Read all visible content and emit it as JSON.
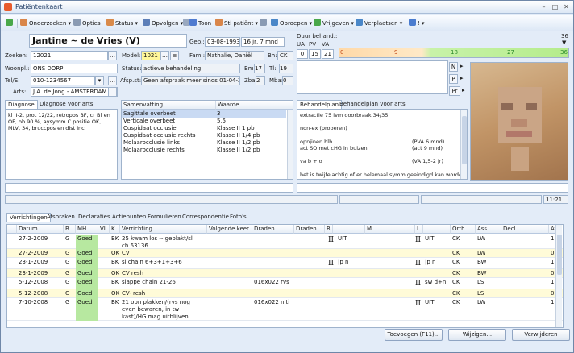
{
  "window": {
    "title": "Patiëntenkaart"
  },
  "toolbar": {
    "items": [
      "Onderzoeken",
      "Opties",
      "Status",
      "Opvolgen",
      "Toon",
      "Stl patiënt",
      "Oproepen",
      "Vrijgeven",
      "Verplaatsen",
      "!"
    ]
  },
  "patient": {
    "name": "Jantine ~ de Vries (V)",
    "geb_label": "Geb.:",
    "geb": "03-08-1993",
    "age": "16 jr, 7 mnd",
    "zoeken_label": "Zoeken:",
    "zoeken": "12021",
    "model_label": "Model:",
    "model": "1021",
    "fam_label": "Fam.:",
    "fam": "Nathalie, Daniël",
    "bh_label": "Bh:",
    "bh": "CK",
    "woonpl_label": "Woonpl.:",
    "woonpl": "ONS DORP",
    "status_label": "Status:",
    "status": "actieve behandeling",
    "bm_label": "Bm:",
    "bm": "17",
    "ti_label": "Tl:",
    "ti": "19",
    "tel_label": "Tel/E:",
    "tel": "010-1234567",
    "afsp_label": "Afsp.st:",
    "afsp": "Geen afspraak meer sinds 01-04-2009",
    "zba_label": "Zba:",
    "zba": "2",
    "mba_label": "Mba:",
    "mba": "0",
    "arts_label": "Arts:",
    "arts": "J.A. de Jong - AMSTERDAM - 020-1234567"
  },
  "duration": {
    "label": "Duur behand.:",
    "cols": [
      "UA",
      "PV",
      "VA"
    ],
    "values": [
      "0",
      "15",
      "21"
    ],
    "scale_ticks": [
      "0",
      "9",
      "18",
      "27",
      "36"
    ],
    "scale_max": "36",
    "progress": 21
  },
  "side_buttons": [
    "N",
    "P",
    "Pr"
  ],
  "diagnose": {
    "tabs": [
      "Diagnose",
      "Diagnose voor arts"
    ],
    "text": "kl II-2, prot 12/22, retropos BF, cr Bf en OF, ob 90 %, aysymm C positie OK, MLV, 34, bruccpos en dist incl"
  },
  "summary": {
    "headers": [
      "Samenvatting",
      "Waarde"
    ],
    "rows": [
      [
        "Sagittale overbeet",
        "3"
      ],
      [
        "Verticale overbeet",
        "5,5"
      ],
      [
        "Cuspidaat occlusie",
        "Klasse II 1 pb"
      ],
      [
        "Cuspidaat occlusie rechts",
        "Klasse II 1/4 pb"
      ],
      [
        "Molaarocclusie links",
        "Klasse II 1/2 pb"
      ],
      [
        "Molaarocclusie rechts",
        "Klasse II 1/2 pb"
      ]
    ]
  },
  "plan": {
    "tabs": [
      "Behandelplan",
      "Behandelplan voor arts"
    ],
    "lines": [
      [
        "extractie 75 ivm doorbraak 34/35",
        ""
      ],
      [
        "",
        ""
      ],
      [
        "non-ex (proberen)",
        ""
      ],
      [
        "",
        ""
      ],
      [
        "opnjinen blb",
        "(PVA 6 mnd)"
      ],
      [
        "act SO met cHG in buizen",
        "(act 9 mnd)"
      ],
      [
        "",
        ""
      ],
      [
        "va b + o",
        "(VA 1,5-2 jr)"
      ],
      [
        "",
        ""
      ],
      [
        "het is twijfelachtig of er helemaal symm geeindigd kan worden",
        ""
      ]
    ]
  },
  "status_time": "11:21",
  "bottom_tabs": [
    "Verrichtingen",
    "Afspraken",
    "Declaraties",
    "Actiepunten",
    "Formulieren",
    "Correspondentie",
    "Foto's"
  ],
  "grid": {
    "headers": [
      "",
      "Datum",
      "B.",
      "MH",
      "VI",
      "K",
      "Verrichting",
      "Volgende keer",
      "Draden",
      "Draden",
      "R..",
      "",
      "M..",
      "",
      "L..",
      "",
      "Orth.",
      "Ass.",
      "Decl.",
      "Af"
    ],
    "rows": [
      {
        "datum": "27-2-2009",
        "b": "G",
        "mh": "Goed",
        "k": "BK",
        "verr": "25 kwam los -- geplakt/sl ch 63136",
        "vk": "",
        "d1": "",
        "d2": "",
        "r": "II",
        "r2": "UIT",
        "l": "II",
        "l2": "UIT",
        "orth": "CK",
        "ass": "LW",
        "af": "1",
        "hl": false
      },
      {
        "datum": "27-2-2009",
        "b": "G",
        "mh": "Goed",
        "k": "OK",
        "verr": "CV",
        "vk": "",
        "d1": "",
        "d2": "",
        "r": "",
        "r2": "",
        "l": "",
        "l2": "",
        "orth": "CK",
        "ass": "LW",
        "af": "0",
        "hl": true
      },
      {
        "datum": "23-1-2009",
        "b": "G",
        "mh": "Goed",
        "k": "BK",
        "verr": "sl chain 6+3+1+3+6",
        "vk": "",
        "d1": "",
        "d2": "",
        "r": "II",
        "r2": "|p n",
        "l": "II",
        "l2": "|p n",
        "orth": "CK",
        "ass": "BW",
        "af": "1",
        "hl": false
      },
      {
        "datum": "23-1-2009",
        "b": "G",
        "mh": "Goed",
        "k": "OK",
        "verr": "CV resh",
        "vk": "",
        "d1": "",
        "d2": "",
        "r": "",
        "r2": "",
        "l": "",
        "l2": "",
        "orth": "CK",
        "ass": "BW",
        "af": "0",
        "hl": true
      },
      {
        "datum": "5-12-2008",
        "b": "G",
        "mh": "Goed",
        "k": "BK",
        "verr": "slappe chain 21-26",
        "vk": "",
        "d1": "016x022 rvs",
        "d2": "",
        "r": "",
        "r2": "",
        "l": "II",
        "l2": "sw d+n",
        "orth": "CK",
        "ass": "LS",
        "af": "1",
        "hl": false
      },
      {
        "datum": "5-12-2008",
        "b": "G",
        "mh": "Goed",
        "k": "OK",
        "verr": "CV- resh",
        "vk": "",
        "d1": "",
        "d2": "",
        "r": "",
        "r2": "",
        "l": "",
        "l2": "",
        "orth": "CK",
        "ass": "LS",
        "af": "0",
        "hl": true
      },
      {
        "datum": "7-10-2008",
        "b": "G",
        "mh": "Goed",
        "k": "BK",
        "verr": "21 opn plakken/(rvs nog even bewaren, in tw kast)/HG mag uitblijven",
        "vk": "",
        "d1": "016x022 niti",
        "d2": "",
        "r": "",
        "r2": "",
        "l": "II",
        "l2": "UIT",
        "orth": "CK",
        "ass": "LW",
        "af": "1",
        "hl": false
      }
    ]
  },
  "buttons": {
    "add": "Toevoegen (F11)...",
    "edit": "Wijzigen...",
    "delete": "Verwijderen"
  }
}
